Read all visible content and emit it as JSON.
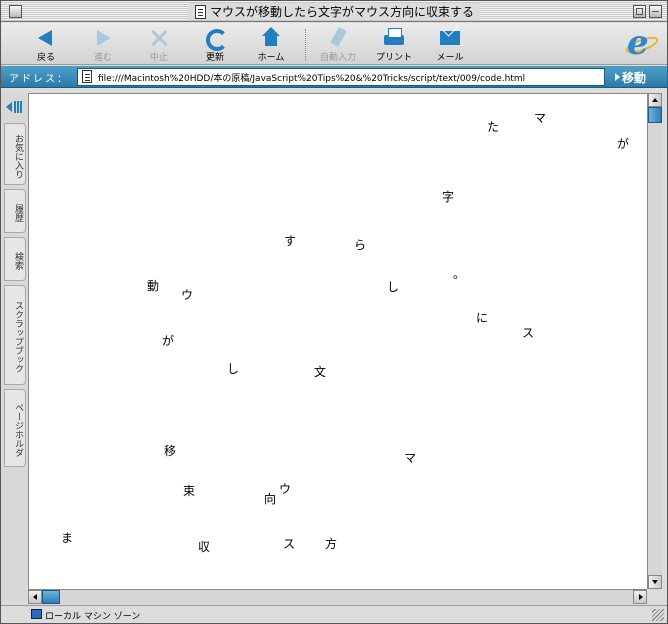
{
  "window": {
    "title": "マウスが移動したら文字がマウス方向に収束する"
  },
  "toolbar": {
    "back": "戻る",
    "forward": "進む",
    "stop": "中止",
    "reload": "更新",
    "home": "ホーム",
    "autofill": "自動入力",
    "print": "プリント",
    "mail": "メール"
  },
  "address": {
    "label": "アドレス：",
    "url": "file:///Macintosh%20HDD/本の原稿/JavaScript%20Tips%20&%20Tricks/script/text/009/code.html",
    "go": "移動"
  },
  "explorer_tabs": [
    "お気に入り",
    "履歴",
    "検索",
    "スクラップブック",
    "ページホルダ"
  ],
  "content": {
    "chars": [
      "た",
      "マ",
      "が",
      "字",
      "す",
      "ら",
      "。",
      "動",
      "ウ",
      "し",
      "に",
      "ス",
      "が",
      "し",
      "文",
      "移",
      "マ",
      "束",
      "ウ",
      "向",
      "ま",
      "収",
      "ス",
      "方"
    ]
  },
  "status": {
    "zone": "ローカル マシン ゾーン"
  },
  "colors": {
    "accent": "#1f7fc0",
    "address_bar": "#3a8cb8"
  }
}
